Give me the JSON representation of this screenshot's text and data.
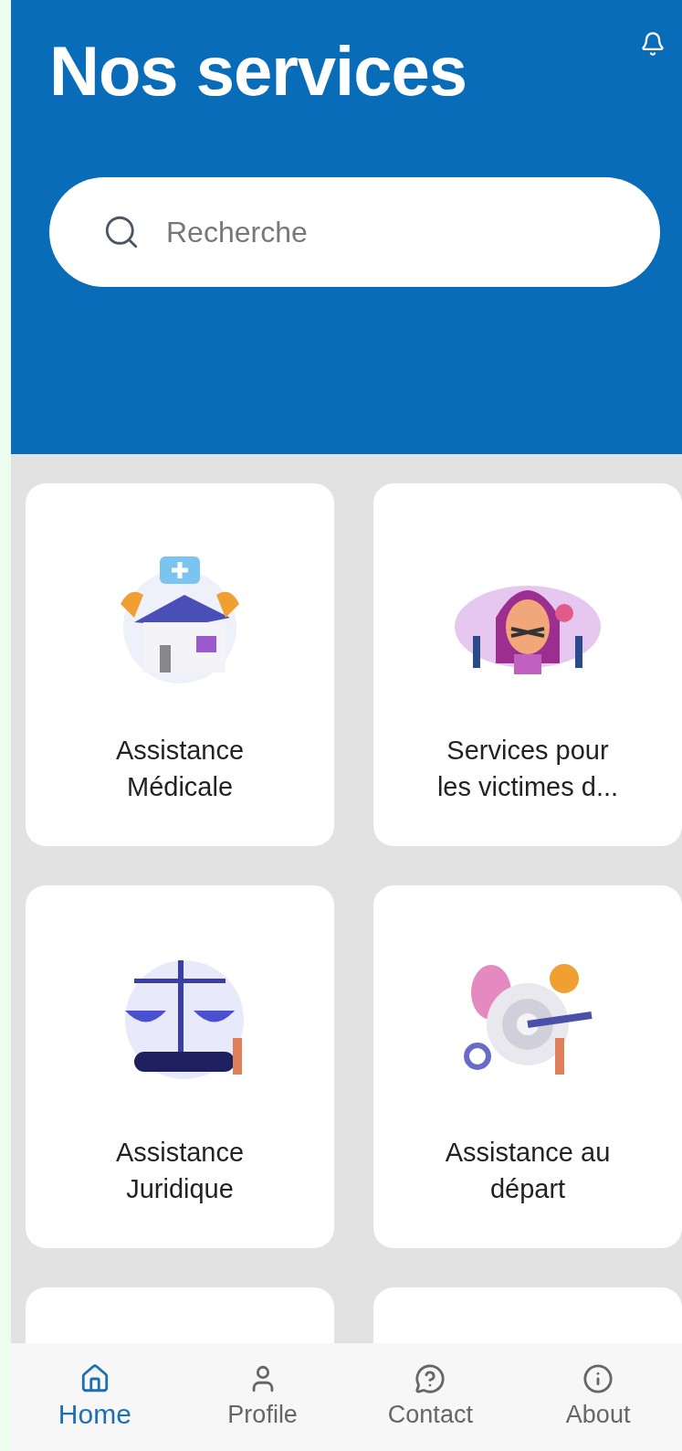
{
  "header": {
    "title": "Nos services"
  },
  "search": {
    "placeholder": "Recherche"
  },
  "services": [
    {
      "title": "Assistance Médicale",
      "kind": "medical"
    },
    {
      "title": "Services pour les victimes d...",
      "kind": "victims"
    },
    {
      "title": "Assistance Juridique",
      "kind": "legal"
    },
    {
      "title": "Assistance au départ",
      "kind": "departure"
    },
    {
      "kind": "blank"
    },
    {
      "kind": "blank"
    }
  ],
  "nav": [
    {
      "label": "Home",
      "kind": "home",
      "selected": true
    },
    {
      "label": "Profile",
      "kind": "profile",
      "selected": false
    },
    {
      "label": "Contact",
      "kind": "contact",
      "selected": false
    },
    {
      "label": "About",
      "kind": "about",
      "selected": false
    }
  ]
}
